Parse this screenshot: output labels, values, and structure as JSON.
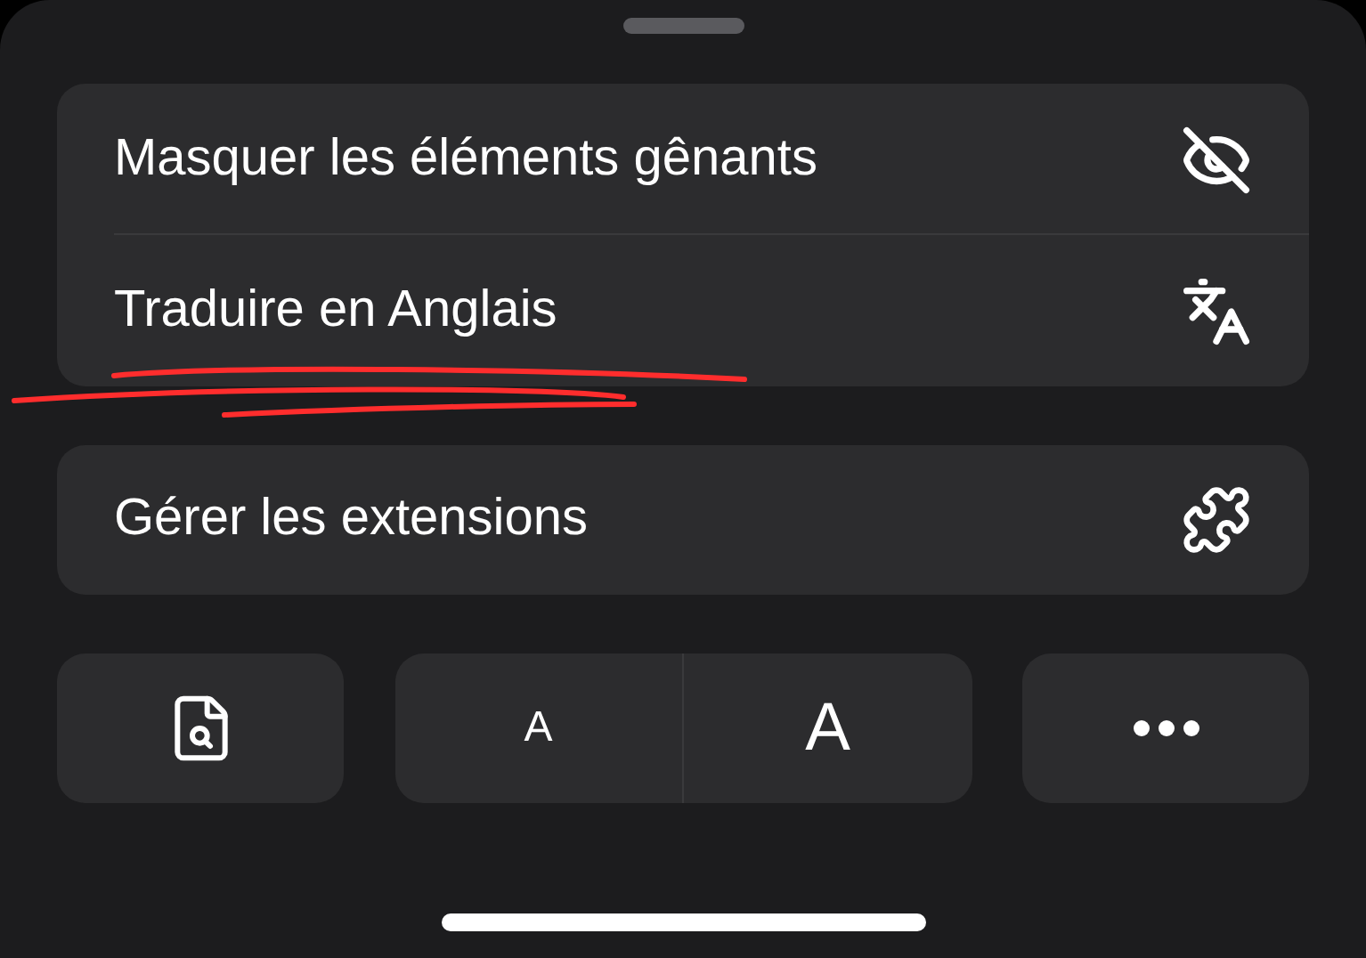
{
  "menu_group": [
    {
      "label": "Masquer les éléments gênants"
    },
    {
      "label": "Traduire en Anglais"
    }
  ],
  "extensions": {
    "label": "Gérer les extensions"
  },
  "toolbar": {
    "font_smaller": "A",
    "font_larger": "A"
  }
}
